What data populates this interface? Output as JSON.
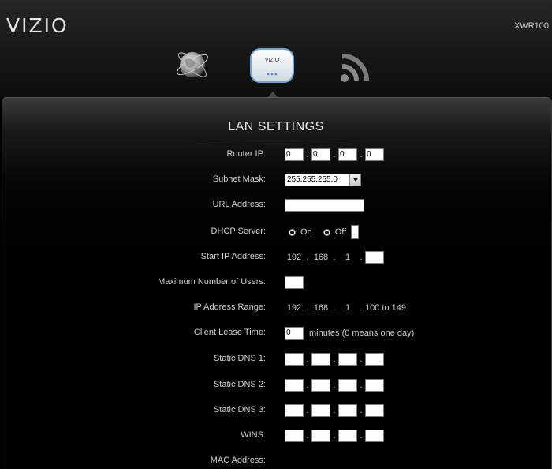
{
  "header": {
    "brand": "VIZIO",
    "model": "XWR100",
    "nav": [
      {
        "icon": "globe-icon"
      },
      {
        "icon": "router-icon",
        "label": "VIZIO",
        "active": true
      },
      {
        "icon": "wifi-icon"
      }
    ]
  },
  "panel": {
    "title": "LAN SETTINGS",
    "fields": {
      "router_ip": {
        "label": "Router IP:",
        "octets": [
          "0",
          "0",
          "0",
          "0"
        ]
      },
      "subnet_mask": {
        "label": "Subnet Mask:",
        "value": "255.255.255.0"
      },
      "url_address": {
        "label": "URL Address:",
        "value": ""
      },
      "dhcp_server": {
        "label": "DHCP Server:",
        "on_label": "On",
        "off_label": "Off"
      },
      "start_ip": {
        "label": "Start IP Address:",
        "octets": [
          "192",
          "168",
          "1"
        ],
        "last": ""
      },
      "max_users": {
        "label": "Maximum Number of Users:",
        "value": ""
      },
      "ip_range": {
        "label": "IP Address Range:",
        "octets": [
          "192",
          "168",
          "1"
        ],
        "range": "100 to 149"
      },
      "lease_time": {
        "label": "Client Lease Time:",
        "value": "0",
        "suffix": "minutes (0 means one day)"
      },
      "dns1": {
        "label": "Static DNS 1:"
      },
      "dns2": {
        "label": "Static DNS 2:"
      },
      "dns3": {
        "label": "Static DNS 3:"
      },
      "wins": {
        "label": "WINS:"
      },
      "mac": {
        "label": "MAC Address:"
      }
    }
  },
  "colors": {
    "background": "#000000",
    "text": "#cfcfcf",
    "title": "#ececec"
  }
}
